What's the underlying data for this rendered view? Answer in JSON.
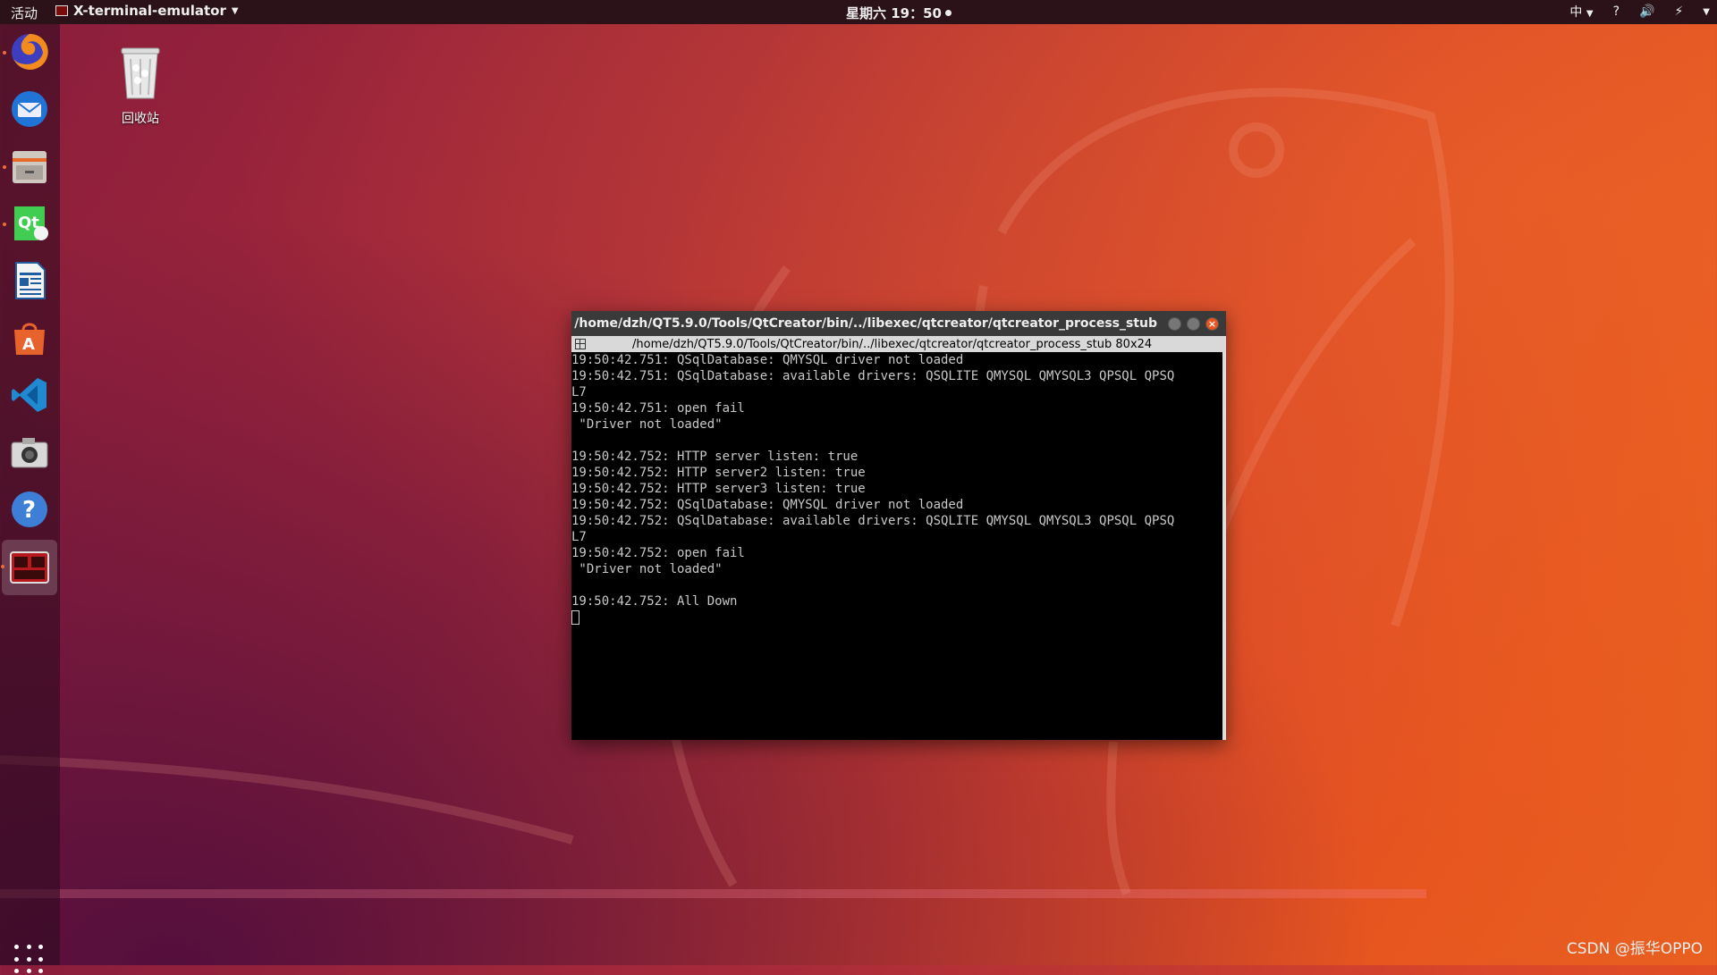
{
  "topbar": {
    "activities": "活动",
    "app_name": "X-terminal-emulator",
    "clock": "星期六 19：50",
    "tray": {
      "input_method": "中",
      "help_icon": "?",
      "volume_icon": "volume-icon",
      "battery_icon": "battery-icon"
    }
  },
  "dock": {
    "items": [
      {
        "name": "firefox-icon"
      },
      {
        "name": "thunderbird-icon"
      },
      {
        "name": "files-icon"
      },
      {
        "name": "qt-creator-icon"
      },
      {
        "name": "libreoffice-writer-icon"
      },
      {
        "name": "software-center-icon"
      },
      {
        "name": "vscode-icon"
      },
      {
        "name": "camera-icon"
      },
      {
        "name": "help-icon"
      },
      {
        "name": "terminal-icon"
      }
    ]
  },
  "desktop": {
    "trash_label": "回收站"
  },
  "terminal": {
    "title": "/home/dzh/QT5.9.0/Tools/QtCreator/bin/../libexec/qtcreator/qtcreator_process_stub",
    "subtitle": "/home/dzh/QT5.9.0/Tools/QtCreator/bin/../libexec/qtcreator/qtcreator_process_stub 80x24",
    "lines": [
      "19:50:42.751: QSqlDatabase: QMYSQL driver not loaded",
      "19:50:42.751: QSqlDatabase: available drivers: QSQLITE QMYSQL QMYSQL3 QPSQL QPSQ",
      "L7",
      "19:50:42.751: open fail",
      " \"Driver not loaded\"",
      "",
      "19:50:42.752: HTTP server listen: true",
      "19:50:42.752: HTTP server2 listen: true",
      "19:50:42.752: HTTP server3 listen: true",
      "19:50:42.752: QSqlDatabase: QMYSQL driver not loaded",
      "19:50:42.752: QSqlDatabase: available drivers: QSQLITE QMYSQL QMYSQL3 QPSQL QPSQ",
      "L7",
      "19:50:42.752: open fail",
      " \"Driver not loaded\"",
      "",
      "19:50:42.752: All Down"
    ]
  },
  "watermark": "CSDN @振华OPPO",
  "colors": {
    "accent": "#e9541f",
    "topbar": "#2a1218",
    "terminal_bg": "#000000"
  }
}
